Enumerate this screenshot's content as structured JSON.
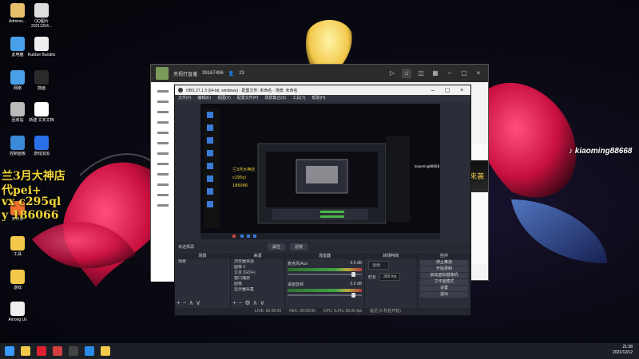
{
  "desktop_icons": [
    {
      "label": "Adminis...",
      "icon": "user-folder-icon"
    },
    {
      "label": "QQ图片 20211204...",
      "icon": "image-file-icon"
    },
    {
      "label": "此电脑",
      "icon": "computer-icon"
    },
    {
      "label": "Rubber Bandits",
      "icon": "game-file-icon"
    },
    {
      "label": "网络",
      "icon": "network-icon"
    },
    {
      "label": "鼓面",
      "icon": "app-icon"
    },
    {
      "label": "回收站",
      "icon": "recycle-bin-icon"
    },
    {
      "label": "新建 文本文档",
      "icon": "text-file-icon"
    },
    {
      "label": "控制面板",
      "icon": "control-panel-icon"
    },
    {
      "label": "游戏加加",
      "icon": "game-booster-icon"
    },
    {
      "label": "天日拿",
      "icon": "app-orange-icon"
    },
    {
      "label": "工具",
      "icon": "folder-icon"
    },
    {
      "label": "游戏",
      "icon": "folder-icon"
    },
    {
      "label": "Among Us",
      "icon": "game-file-icon"
    }
  ],
  "overlay": {
    "line1": "兰3月大神店",
    "line2": "代pei+",
    "line3": "vx c295ql",
    "line4": "y 186066",
    "tiktok_id": "kiaoming88668"
  },
  "back_window": {
    "title": "央视打直播",
    "room_id": "39167496",
    "viewer_count": "23",
    "banner": "来袭"
  },
  "obs": {
    "title": "OBS 27.1.3 (64-bit, windows) - 配置文件: 未命名 - 场景: 未命名",
    "menu": [
      "文件(F)",
      "编辑(E)",
      "视图(V)",
      "配置文件(P)",
      "场景集合(S)",
      "工具(T)",
      "帮助(H)"
    ],
    "bottom_bar": {
      "label": "未选择源",
      "props": "属性",
      "filters": "滤镜"
    },
    "docks": {
      "scenes": {
        "header": "场景",
        "items": [
          "场景"
        ]
      },
      "sources": {
        "header": "来源",
        "items": [
          "浏览器资源",
          "图像 2",
          "文本 (GDI+)",
          "窗口捕获",
          "图像",
          "显示器采集"
        ]
      },
      "mixer": {
        "header": "混音器",
        "channels": [
          {
            "name": "麦克风/Aux",
            "db": "0.0 dB"
          },
          {
            "name": "桌面音频",
            "db": "0.0 dB"
          }
        ]
      },
      "transitions": {
        "header": "转场特效",
        "type": "淡出",
        "duration_label": "时长",
        "duration": "300 ms"
      },
      "controls": {
        "header": "控件",
        "buttons": [
          "停止推流",
          "开始录制",
          "启动虚拟摄像机",
          "工作室模式",
          "设置",
          "退出"
        ]
      }
    },
    "status": {
      "live": "LIVE: 00:00:00",
      "rec": "REC: 00:00:00",
      "cpu": "CPU: 0.2%, 30.00 fps",
      "drop": "延迟 (5 秒后开始)"
    }
  },
  "taskbar": {
    "time": "21:38",
    "date": "2021/12/12",
    "apps": [
      "start-icon",
      "file-explorer-icon",
      "netease-music-icon",
      "app-red-icon",
      "obs-icon",
      "qq-icon",
      "folder-icon"
    ]
  },
  "colors": {
    "overlay_text": "#f2d53a",
    "obs_bg": "#2b2e38",
    "taskbar": "#1c1f26",
    "wallpaper_pink": "#e0245e"
  }
}
